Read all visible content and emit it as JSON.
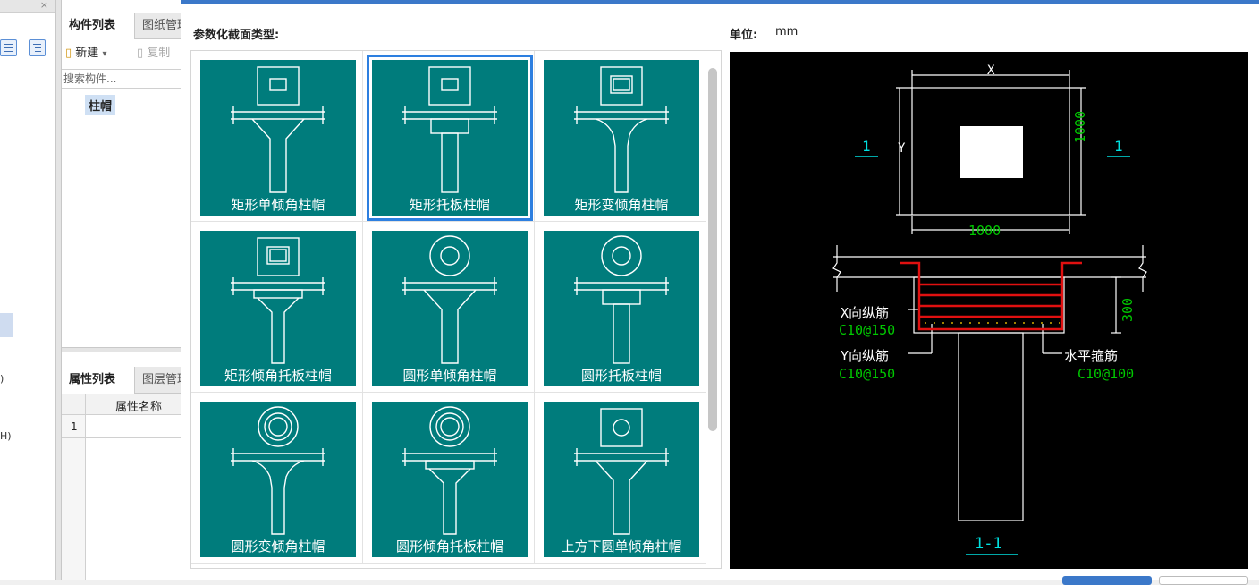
{
  "left_panel": {
    "close_glyph": "×",
    "fragments": [
      ")",
      "H)"
    ]
  },
  "component_panel": {
    "tabs": [
      "构件列表",
      "图纸管理"
    ],
    "new_label": "新建",
    "new_arrow": "▾",
    "copy_label": "复制",
    "search_placeholder": "搜索构件...",
    "tree_item": "柱帽"
  },
  "property_panel": {
    "tabs": [
      "属性列表",
      "图层管理"
    ],
    "header": "属性名称",
    "row_num": "1"
  },
  "dialog": {
    "section_label": "参数化截面类型:",
    "unit_label": "单位:",
    "unit_value": "mm",
    "selected_index": 1,
    "items": [
      {
        "label": "矩形单倾角柱帽",
        "top": "square",
        "body": "single"
      },
      {
        "label": "矩形托板柱帽",
        "top": "square",
        "body": "plate"
      },
      {
        "label": "矩形变倾角柱帽",
        "top": "square-double",
        "body": "variable"
      },
      {
        "label": "矩形倾角托板柱帽",
        "top": "square-double",
        "body": "plate-angle"
      },
      {
        "label": "圆形单倾角柱帽",
        "top": "circle",
        "body": "single"
      },
      {
        "label": "圆形托板柱帽",
        "top": "circle",
        "body": "plate"
      },
      {
        "label": "圆形变倾角柱帽",
        "top": "circle-double",
        "body": "variable"
      },
      {
        "label": "圆形倾角托板柱帽",
        "top": "circle-double",
        "body": "plate-angle"
      },
      {
        "label": "上方下圆单倾角柱帽",
        "top": "square-circle",
        "body": "single"
      }
    ]
  },
  "preview": {
    "colors": {
      "bg": "#000000",
      "line": "#ffffff",
      "dim_green": "#00c800",
      "cyan": "#00e0e0",
      "rebar_red": "#e01010",
      "stirrup_yellow": "#ffd000"
    },
    "dim_x": "X",
    "dim_y": "Y",
    "dim_width": "1000",
    "dim_height": "1000",
    "section_mark": "1",
    "section_title": "1-1",
    "x_rebar_label": "X向纵筋",
    "x_rebar_value": "C10@150",
    "y_rebar_label": "Y向纵筋",
    "y_rebar_value": "C10@150",
    "stirrup_label": "水平箍筋",
    "stirrup_value": "C10@100",
    "thickness": "300"
  }
}
